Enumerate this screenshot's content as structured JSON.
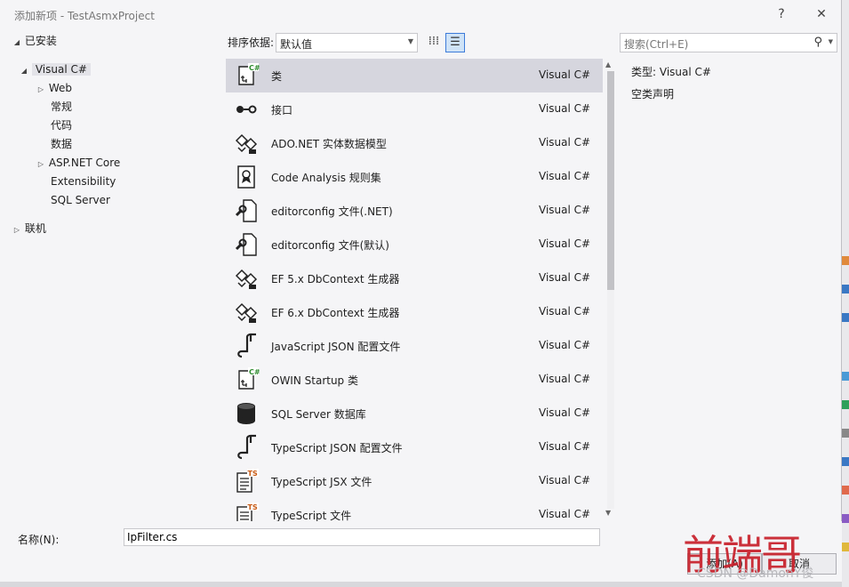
{
  "window": {
    "title": "添加新项 - TestAsmxProject",
    "help": "?",
    "close": "✕"
  },
  "tree": {
    "installed": "已安装",
    "items": [
      {
        "label": "Visual C#"
      },
      {
        "label": "Web"
      },
      {
        "label": "常规"
      },
      {
        "label": "代码"
      },
      {
        "label": "数据"
      },
      {
        "label": "ASP.NET Core"
      },
      {
        "label": "Extensibility"
      },
      {
        "label": "SQL Server"
      }
    ],
    "online": "联机"
  },
  "toolbar": {
    "sort_label": "排序依据:",
    "sort_value": "默认值",
    "search_placeholder": "搜索(Ctrl+E)"
  },
  "templates": [
    {
      "name": "类",
      "category": "Visual C#",
      "icon": "csharp-class-icon"
    },
    {
      "name": "接口",
      "category": "Visual C#",
      "icon": "interface-icon"
    },
    {
      "name": "ADO.NET 实体数据模型",
      "category": "Visual C#",
      "icon": "data-model-icon"
    },
    {
      "name": "Code Analysis 规则集",
      "category": "Visual C#",
      "icon": "ruleset-icon"
    },
    {
      "name": "editorconfig 文件(.NET)",
      "category": "Visual C#",
      "icon": "editorconfig-icon"
    },
    {
      "name": "editorconfig 文件(默认)",
      "category": "Visual C#",
      "icon": "editorconfig-icon"
    },
    {
      "name": "EF 5.x DbContext 生成器",
      "category": "Visual C#",
      "icon": "data-model-icon"
    },
    {
      "name": "EF 6.x DbContext 生成器",
      "category": "Visual C#",
      "icon": "data-model-icon"
    },
    {
      "name": "JavaScript JSON 配置文件",
      "category": "Visual C#",
      "icon": "json-config-icon"
    },
    {
      "name": "OWIN Startup 类",
      "category": "Visual C#",
      "icon": "csharp-class-icon"
    },
    {
      "name": "SQL Server 数据库",
      "category": "Visual C#",
      "icon": "database-icon"
    },
    {
      "name": "TypeScript JSON 配置文件",
      "category": "Visual C#",
      "icon": "json-config-icon"
    },
    {
      "name": "TypeScript JSX 文件",
      "category": "Visual C#",
      "icon": "typescript-file-icon"
    },
    {
      "name": "TypeScript 文件",
      "category": "Visual C#",
      "icon": "typescript-file-icon"
    }
  ],
  "details": {
    "type_label": "类型:",
    "type_value": "Visual C#",
    "description": "空类声明"
  },
  "bottom": {
    "name_label": "名称(N):",
    "name_value": "IpFilter.cs",
    "add_button": "添加(A)",
    "cancel_button": "取消"
  },
  "watermark": {
    "text": "前端哥",
    "csdn": "CSDN @DamonY俊"
  },
  "colors": {
    "selected_row": "#d6d6de",
    "view_active_border": "#3d7bd9",
    "watermark": "#c8202a",
    "cs_green": "#2e8b2e",
    "ts_orange": "#c85a14"
  }
}
